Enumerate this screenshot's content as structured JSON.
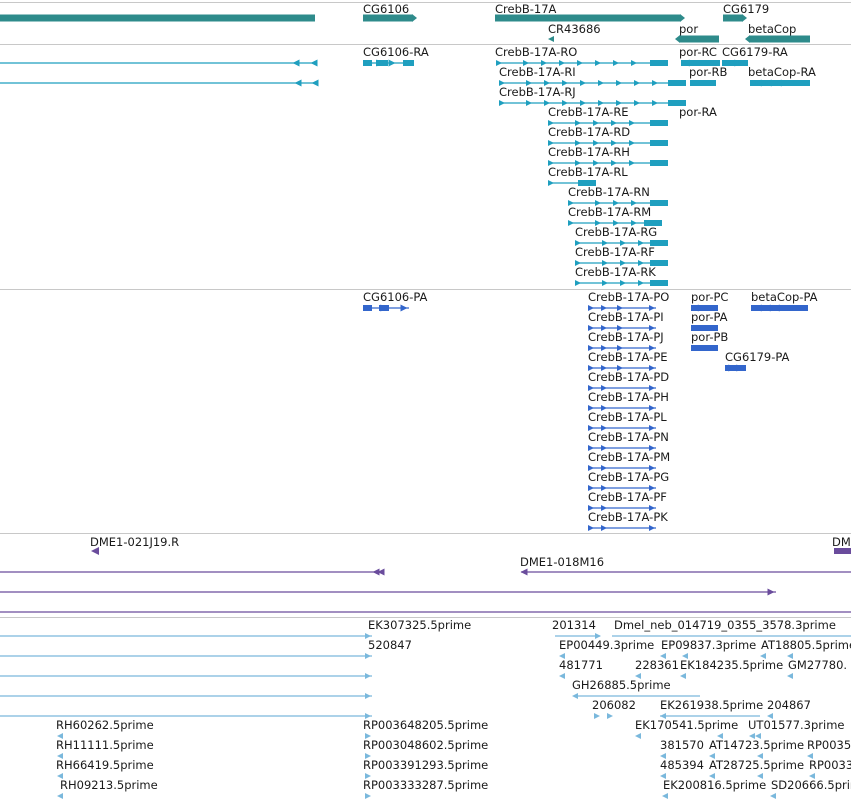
{
  "colors": {
    "gene": "#2e8b8b",
    "transcript": "#1f9fbf",
    "protein": "#3366cc",
    "clone": "#6a4c9c",
    "est": "#7ab8dc",
    "divider": "#c8c8c8"
  },
  "icons": {
    "arrow_left": "arrow-left-icon",
    "arrow_right": "arrow-right-icon"
  },
  "tracks": {
    "genes": {
      "labels": {
        "cg6106": "CG6106",
        "crebb": "CrebB-17A",
        "cg6179": "CG6179",
        "cr43686": "CR43686",
        "por": "por",
        "betacop": "betaCop"
      }
    },
    "transcripts": {
      "labels": {
        "cg6106_ra": "CG6106-RA",
        "ro": "CrebB-17A-RO",
        "ri": "CrebB-17A-RI",
        "rj": "CrebB-17A-RJ",
        "re": "CrebB-17A-RE",
        "rd": "CrebB-17A-RD",
        "rh": "CrebB-17A-RH",
        "rl": "CrebB-17A-RL",
        "rn": "CrebB-17A-RN",
        "rm": "CrebB-17A-RM",
        "rg": "CrebB-17A-RG",
        "rf": "CrebB-17A-RF",
        "rk": "CrebB-17A-RK",
        "por_rc": "por-RC",
        "cg6179_ra": "CG6179-RA",
        "por_rb": "por-RB",
        "betacop_ra": "betaCop-RA",
        "por_ra": "por-RA"
      }
    },
    "proteins": {
      "labels": {
        "cg6106_pa": "CG6106-PA",
        "po": "CrebB-17A-PO",
        "pi": "CrebB-17A-PI",
        "pj": "CrebB-17A-PJ",
        "pe": "CrebB-17A-PE",
        "pd": "CrebB-17A-PD",
        "ph": "CrebB-17A-PH",
        "pl": "CrebB-17A-PL",
        "pn": "CrebB-17A-PN",
        "pm": "CrebB-17A-PM",
        "pg": "CrebB-17A-PG",
        "pf": "CrebB-17A-PF",
        "pk": "CrebB-17A-PK",
        "por_pc": "por-PC",
        "por_pa": "por-PA",
        "por_pb": "por-PB",
        "betacop_pa": "betaCop-PA",
        "cg6179_pa": "CG6179-PA"
      }
    },
    "clones": {
      "labels": {
        "c021j19": "DME1-021J19.R",
        "c018m16": "DME1-018M16",
        "dm": "DM"
      }
    },
    "ests": {
      "labels": {
        "ek307325": "EK307325.5prime",
        "e201314": "201314",
        "dmel_neb": "Dmel_neb_014719_0355_3578.3prime",
        "e520847": "520847",
        "ep00449": "EP00449.3prime",
        "ep09837": "EP09837.3prime",
        "at18805": "AT18805.5prime",
        "e481771": "481771",
        "e228361": "228361",
        "ek184235": "EK184235.5prime",
        "gm27780": "GM27780.",
        "gh26885": "GH26885.5prime",
        "e206082": "206082",
        "ek261938": "EK261938.5prime",
        "e204867": "204867",
        "rh60262": "RH60262.5prime",
        "rp003648205": "RP003648205.5prime",
        "ek170541": "EK170541.5prime",
        "ut01577": "UT01577.3prime",
        "rh11111": "RH11111.5prime",
        "rp003048602": "RP003048602.5prime",
        "e381570": "381570",
        "at14723": "AT14723.5prime",
        "rp0035": "RP0035",
        "rh66419": "RH66419.5prime",
        "rp003391293": "RP003391293.5prime",
        "e485394": "485394",
        "at28725": "AT28725.5prime",
        "rp0033": "RP0033",
        "rh09213": "RH09213.5prime",
        "rp003333287": "RP003333287.5prime",
        "ek200816": "EK200816.5prime",
        "sd20666": "SD20666.5prime"
      }
    }
  }
}
